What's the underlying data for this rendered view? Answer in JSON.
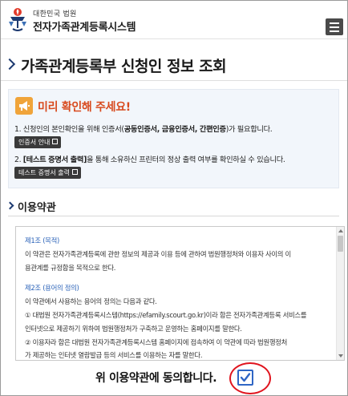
{
  "header": {
    "brand_small": "대한민국 법원",
    "brand_title": "전자가족관계등록시스템"
  },
  "page_title": "가족관계등록부 신청인 정보 조회",
  "notice": {
    "title": "미리 확인해 주세요!",
    "line1_pre": "1. 신청인의 본인확인을 위해 인증서(",
    "line1_bold": "공동인증서, 금융인증서, 간편인증",
    "line1_post": ")가 필요합니다.",
    "button1": "인증서 안내",
    "line2_pre": "2. ",
    "line2_bold": "[테스트 증명서 출력]",
    "line2_post": "을 통해 소유하신 프린터의 정상 출력 여부를 확인하실 수 있습니다.",
    "button2": "테스트 증명서 출력"
  },
  "terms": {
    "heading": "이용약관",
    "art1_title": "제1조 (목적)",
    "art1_l1": "이 약관은 전자가족관계등록에 관한 정보의 제공과 이용 등에 관하여 법원행정처와 이용자 사이의 이",
    "art1_l2": "용관계를 규정함을 목적으로 한다.",
    "art2_title": "제2조 (용어의 정의)",
    "art2_l1": "이 약관에서 사용하는 용어의 정의는 다음과 같다.",
    "art2_l2": "① 대법원 전자가족관계등록시스템(https://efamily.scourt.go.kr)이라 함은 전자가족관계등록 서비스를",
    "art2_l3": "인터넷으로 제공하기 위하여 법원행정처가 구축하고 운영하는 홈페이지를 말한다.",
    "art2_l4": "② 이용자라 함은 대법원 전자가족관계등록시스템 홈페이지에 접속하여 이 약관에 따라 법원행정처",
    "art2_l5": "가 제공하는 인터넷 열람발급 등의 서비스를 이용하는 자를 말한다."
  },
  "agree_label": "위 이용약관에 동의합니다.",
  "agree_checked": true,
  "icons": {
    "logo": "court-emblem-icon",
    "menu": "hamburger-menu-icon",
    "notice": "megaphone-icon",
    "external": "external-link-icon",
    "check": "checkmark-icon"
  },
  "colors": {
    "accent_red": "#d84a1e",
    "link_blue": "#2a62b8",
    "check_blue": "#2f66c5",
    "highlight_red": "#e0141e"
  }
}
